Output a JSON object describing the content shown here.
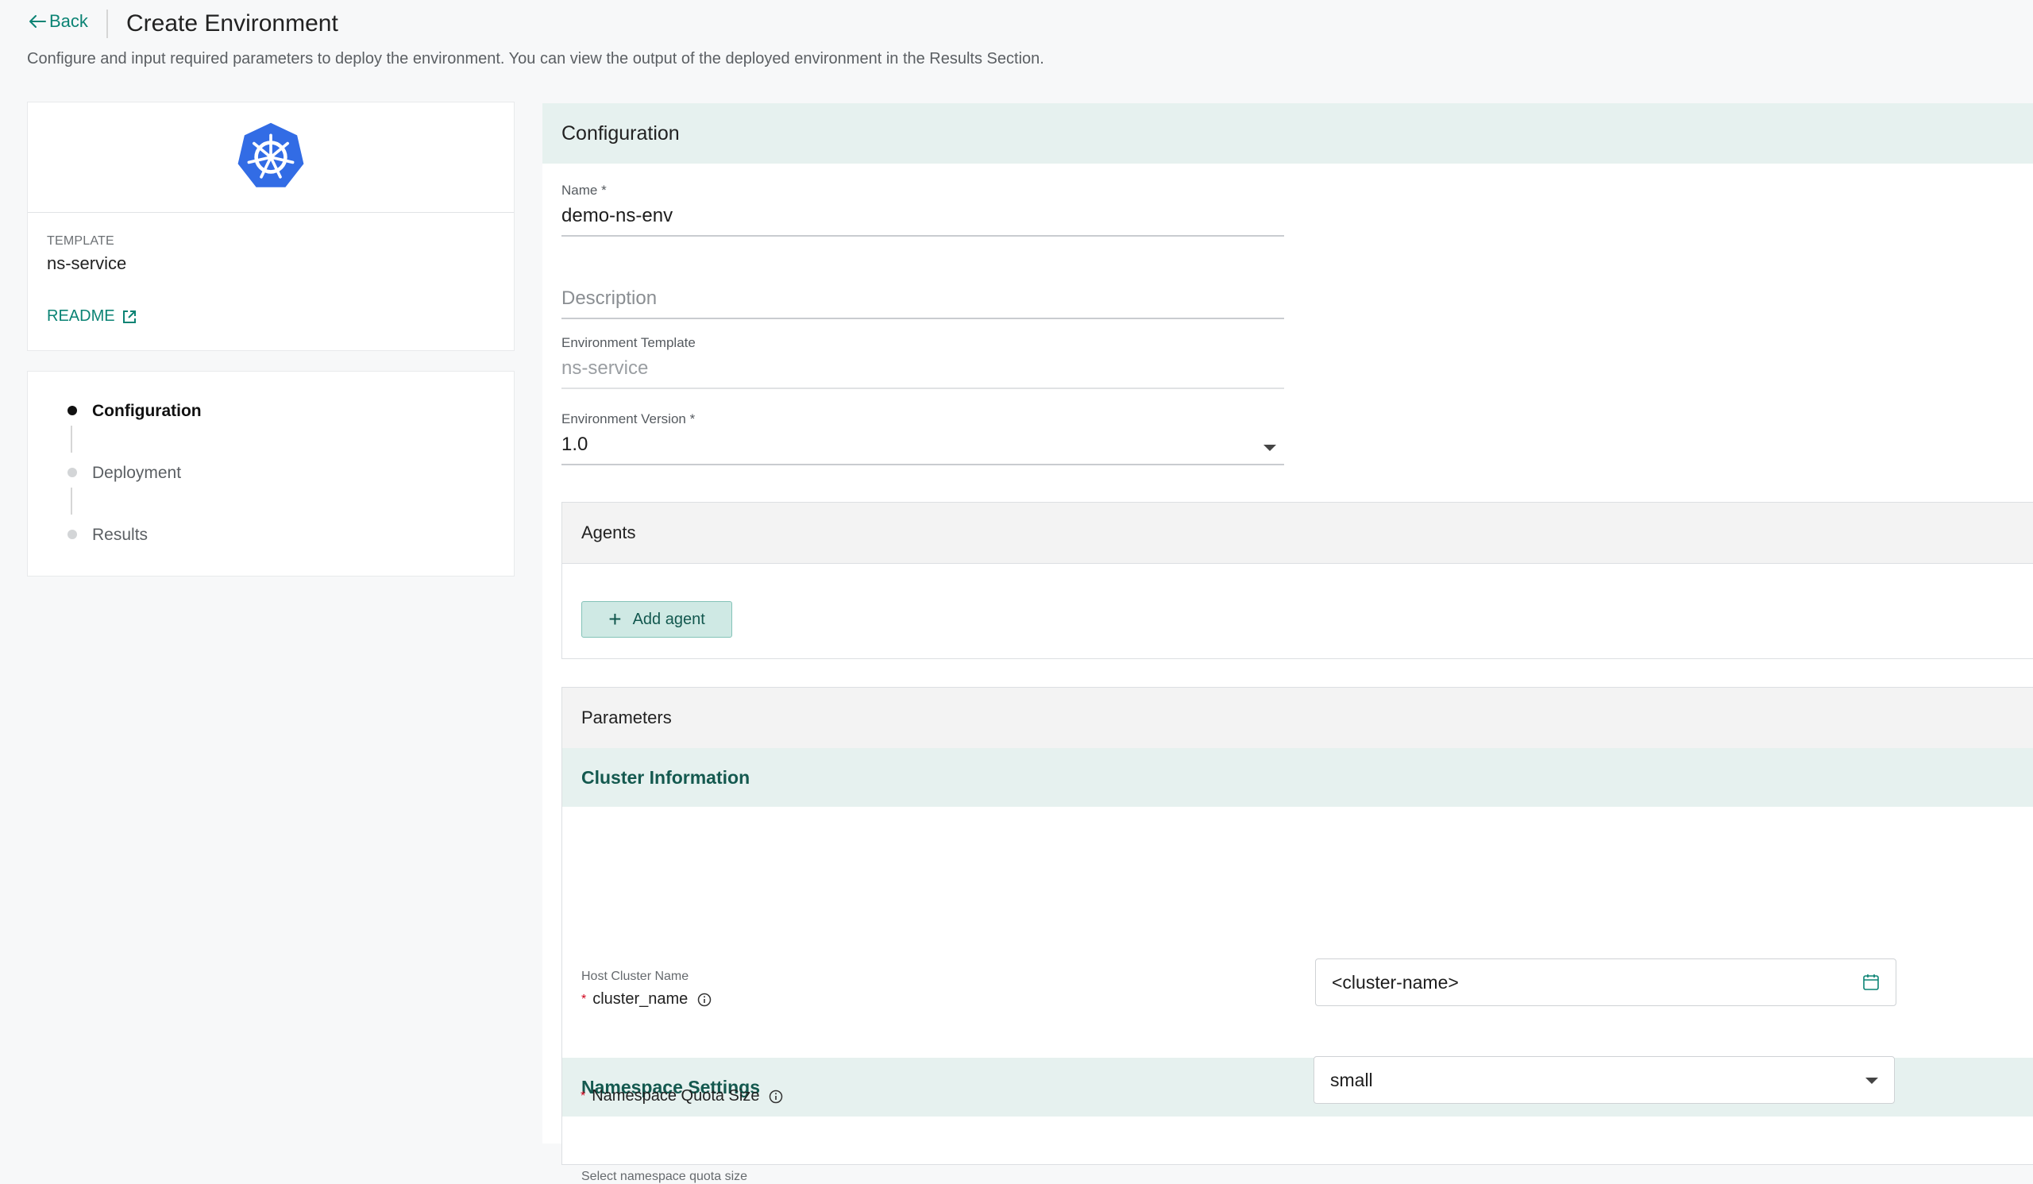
{
  "header": {
    "back_label": "Back",
    "title": "Create Environment",
    "subtitle": "Configure and input required parameters to deploy the environment. You can view the output of the deployed environment in the Results Section."
  },
  "template_card": {
    "logo_icon": "kubernetes-logo",
    "caption": "TEMPLATE",
    "name": "ns-service",
    "readme_label": "README"
  },
  "steps": [
    {
      "label": "Configuration",
      "state": "active"
    },
    {
      "label": "Deployment",
      "state": "pending"
    },
    {
      "label": "Results",
      "state": "pending"
    }
  ],
  "configuration": {
    "title": "Configuration",
    "name_field": {
      "label": "Name *",
      "value": "demo-ns-env"
    },
    "description_field": {
      "placeholder": "Description"
    },
    "template_field": {
      "label": "Environment Template",
      "value": "ns-service"
    },
    "version_field": {
      "label": "Environment Version *",
      "value": "1.0"
    }
  },
  "agents": {
    "title": "Agents",
    "add_button_label": "Add agent"
  },
  "parameters": {
    "title": "Parameters",
    "groups": [
      {
        "title": "Cluster Information",
        "param": {
          "description": "Host Cluster Name",
          "required_mark": "*",
          "name": "cluster_name",
          "value": "<cluster-name>"
        }
      },
      {
        "title": "Namespace Settings",
        "param": {
          "description": "Select namespace quota size",
          "required_mark": "*",
          "name": "Namespace Quota Size",
          "value": "small"
        }
      }
    ]
  },
  "colors": {
    "accent": "#0b8374",
    "header_band": "#e6f1ef",
    "kubernetes_blue": "#326ce5"
  }
}
